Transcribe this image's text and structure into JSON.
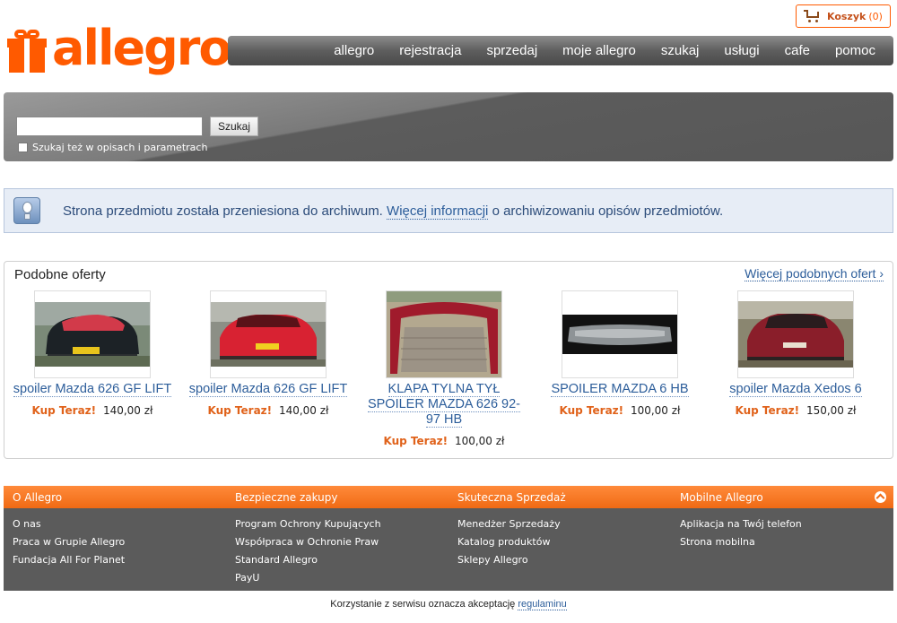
{
  "header": {
    "logo_text": "allegro",
    "cart": {
      "label": "Koszyk",
      "count": "(0)",
      "icon": "cart-icon"
    }
  },
  "nav": {
    "items": [
      "allegro",
      "rejestracja",
      "sprzedaj",
      "moje allegro",
      "szukaj",
      "usługi",
      "cafe",
      "pomoc"
    ]
  },
  "search": {
    "value": "",
    "button_label": "Szukaj",
    "checkbox_label": "Szukaj też w opisach i parametrach",
    "checked": false
  },
  "info": {
    "icon": "lightbulb-icon",
    "text_before": "Strona przedmiotu została przeniesiona do archiwum.",
    "link_text": "Więcej informacji",
    "text_after": "o archiwizowaniu opisów przedmiotów."
  },
  "similar": {
    "title": "Podobne oferty",
    "more_link": "Więcej podobnych ofert ›",
    "buy_now_label": "Kup Teraz!",
    "items": [
      {
        "title": "spoiler Mazda 626 GF LIFT",
        "price": "140,00 zł"
      },
      {
        "title": "spoiler Mazda 626 GF LIFT",
        "price": "140,00 zł"
      },
      {
        "title": "KLAPA TYLNA TYŁ SPOILER MAZDA 626 92-97 HB",
        "price": "100,00 zł"
      },
      {
        "title": "SPOILER MAZDA 6 HB",
        "price": "100,00 zł"
      },
      {
        "title": "spoiler Mazda Xedos 6",
        "price": "150,00 zł"
      }
    ]
  },
  "footer": {
    "columns": [
      {
        "heading": "O Allegro",
        "links": [
          "O nas",
          "Praca w Grupie Allegro",
          "Fundacja All For Planet"
        ]
      },
      {
        "heading": "Bezpieczne zakupy",
        "links": [
          "Program Ochrony Kupujących",
          "Współpraca w Ochronie Praw",
          "Standard Allegro",
          "PayU"
        ]
      },
      {
        "heading": "Skuteczna Sprzedaż",
        "links": [
          "Menedżer Sprzedaży",
          "Katalog produktów",
          "Sklepy Allegro"
        ]
      },
      {
        "heading": "Mobilne Allegro",
        "links": [
          "Aplikacja na Twój telefon",
          "Strona mobilna"
        ]
      }
    ]
  },
  "terms": {
    "text": "Korzystanie z serwisu oznacza akceptację",
    "link": "regulaminu"
  },
  "colors": {
    "brand_orange": "#ff5a00",
    "link_blue": "#2c5d9a",
    "footer_bg": "#5b5b5b",
    "info_bg": "#e7edf6"
  }
}
